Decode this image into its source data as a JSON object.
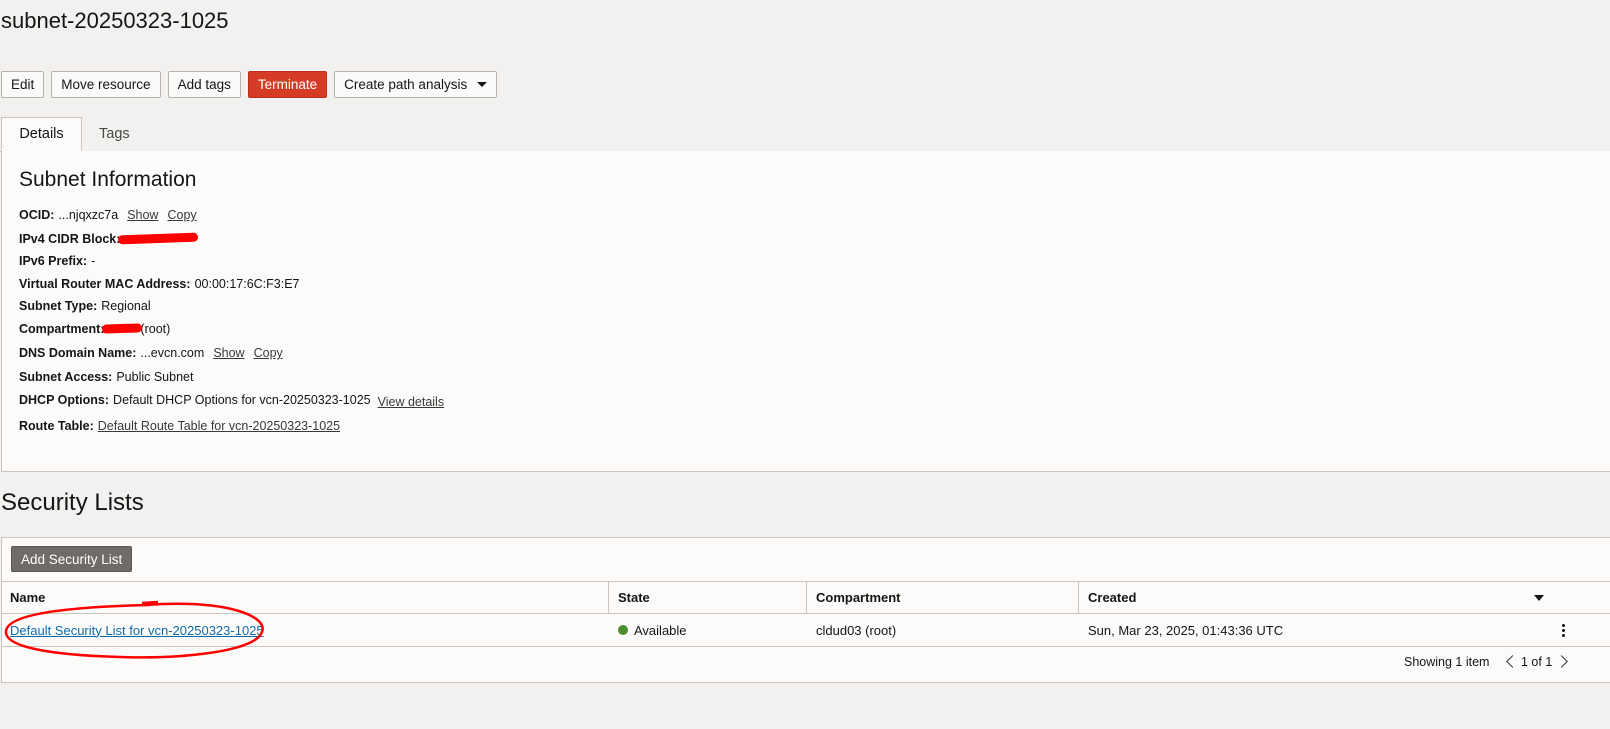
{
  "page": {
    "title": "subnet-20250323-1025"
  },
  "actions": {
    "edit": "Edit",
    "move": "Move resource",
    "add_tags": "Add tags",
    "terminate": "Terminate",
    "path_analysis": "Create path analysis"
  },
  "tabs": {
    "details": "Details",
    "tags": "Tags"
  },
  "info": {
    "title": "Subnet Information",
    "ocid_label": "OCID:",
    "ocid_value": "...njqxzc7a",
    "show": "Show",
    "copy": "Copy",
    "ipv4_label": "IPv4 CIDR Block:",
    "ipv6_label": "IPv6 Prefix:",
    "ipv6_value": "-",
    "mac_label": "Virtual Router MAC Address:",
    "mac_value": "00:00:17:6C:F3:E7",
    "type_label": "Subnet Type:",
    "type_value": "Regional",
    "compartment_label": "Compartment:",
    "compartment_suffix": "(root)",
    "dns_label": "DNS Domain Name:",
    "dns_value": "...evcn.com",
    "access_label": "Subnet Access:",
    "access_value": "Public Subnet",
    "dhcp_label": "DHCP Options:",
    "dhcp_value": "Default DHCP Options for vcn-20250323-1025",
    "view_details": "View details",
    "route_label": "Route Table:",
    "route_value": "Default Route Table for vcn-20250323-1025"
  },
  "security_lists": {
    "title": "Security Lists",
    "add_button": "Add Security List",
    "columns": [
      "Name",
      "State",
      "Compartment",
      "Created"
    ],
    "rows": [
      {
        "name": "Default Security List for vcn-20250323-1025",
        "state": "Available",
        "compartment": "cldud03 (root)",
        "created": "Sun, Mar 23, 2025, 01:43:36 UTC"
      }
    ],
    "showing": "Showing 1 item",
    "pagination": "1 of 1"
  },
  "colors": {
    "terminate": "#d63b25",
    "link": "#0f6ba8",
    "state_available": "#4d8c2f",
    "annotation": "#ff0000"
  }
}
